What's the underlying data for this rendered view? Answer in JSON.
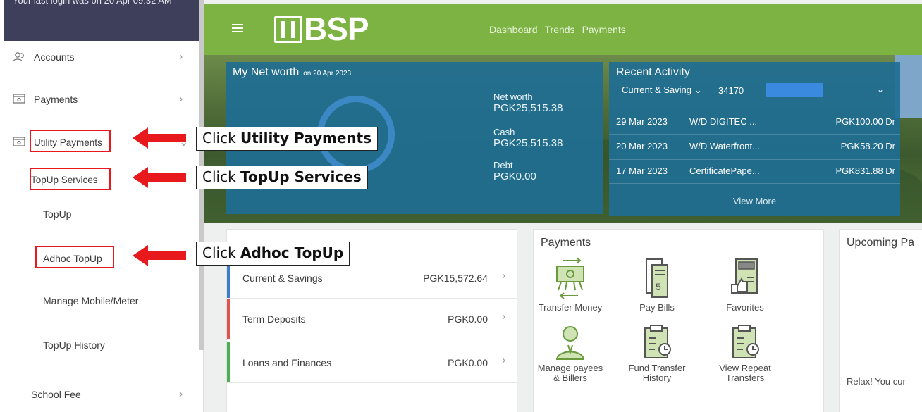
{
  "sidebar": {
    "login_text": "Your last login was on 20 Apr 09:32 AM",
    "items": [
      {
        "icon": "accounts-icon",
        "label": "Accounts"
      },
      {
        "icon": "payments-icon",
        "label": "Payments"
      },
      {
        "icon": "utility-payments-icon",
        "label": "Utility Payments"
      }
    ],
    "topup_services": "TopUp Services",
    "sub_items": [
      "TopUp",
      "Adhoc TopUp",
      "Manage Mobile/Meter",
      "TopUp History"
    ],
    "school_fee": "School Fee"
  },
  "topbar": {
    "brand": "BSP",
    "nav": [
      "Dashboard",
      "Trends",
      "Payments"
    ]
  },
  "networth": {
    "title": "My Net worth",
    "date": "on 20 Apr 2023",
    "rows": [
      {
        "label": "Net worth",
        "value": "PGK25,515.38"
      },
      {
        "label": "Cash",
        "value": "PGK25,515.38"
      },
      {
        "label": "Debt",
        "value": "PGK0.00"
      }
    ]
  },
  "recent": {
    "title": "Recent Activity",
    "account_type": "Current & Saving",
    "account_number": "34170",
    "transactions": [
      {
        "date": "29 Mar 2023",
        "desc": "W/D DIGITEC ...",
        "amount": "PGK100.00 Dr"
      },
      {
        "date": "20 Mar 2023",
        "desc": "W/D Waterfront...",
        "amount": "PGK58.20 Dr"
      },
      {
        "date": "17 Mar 2023",
        "desc": "CertificatePape...",
        "amount": "PGK831.88 Dr"
      }
    ],
    "view_more": "View More"
  },
  "accounts": [
    {
      "name": "Current & Savings",
      "balance": "PGK15,572.64",
      "color": "#3b7fc4"
    },
    {
      "name": "Term Deposits",
      "balance": "PGK0.00",
      "color": "#e0524e"
    },
    {
      "name": "Loans and Finances",
      "balance": "PGK0.00",
      "color": "#4caf50"
    }
  ],
  "payments_card": {
    "title": "Payments",
    "items": [
      {
        "label": "Transfer Money",
        "icon": "transfer-money-icon"
      },
      {
        "label": "Pay Bills",
        "icon": "pay-bills-icon"
      },
      {
        "label": "Favorites",
        "icon": "favorites-icon"
      },
      {
        "label": "Manage payees & Billers",
        "icon": "manage-payees-icon"
      },
      {
        "label": "Fund Transfer History",
        "icon": "fund-transfer-history-icon"
      },
      {
        "label": "View Repeat Transfers",
        "icon": "view-repeat-transfers-icon"
      }
    ]
  },
  "upcoming": {
    "title": "Upcoming Pa",
    "message": "Relax! You cur"
  },
  "callouts": [
    {
      "prefix": "Click ",
      "bold": "Utility Payments"
    },
    {
      "prefix": "Click ",
      "bold": "TopUp Services"
    },
    {
      "prefix": "Click ",
      "bold": "Adhoc TopUp"
    }
  ],
  "colors": {
    "brand_green": "#7cb342",
    "panel_blue": "#206e94",
    "highlight_red": "#e8191d"
  }
}
